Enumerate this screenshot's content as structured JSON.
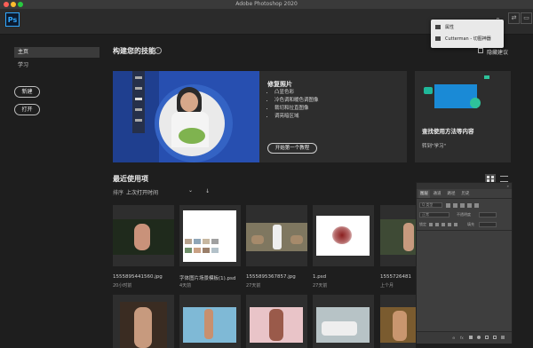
{
  "titlebar": {
    "title": "Adobe Photoshop 2020"
  },
  "app": {
    "logo": "Ps"
  },
  "icons": {
    "search": "⌕",
    "ps": "Ps"
  },
  "window_buttons": [
    "⇄",
    "▭"
  ],
  "sidebar": {
    "items": [
      {
        "label": "主页"
      },
      {
        "label": "学习"
      }
    ],
    "new_button": "新建",
    "open_button": "打开"
  },
  "skills": {
    "title": "构建您的技能",
    "hide_suggestions": "隐藏建议",
    "hero": {
      "heading": "修复照片",
      "bullets": [
        "凸显色彩",
        "冷色调和暖色调图像",
        "裁切和拉直图像",
        "调亮暗区域"
      ],
      "cta": "开始第一个教程"
    },
    "learn_card": {
      "heading": "查找使用方法等内容",
      "link": "转到\"学习\""
    }
  },
  "recent": {
    "title": "最近使用项",
    "sort_label": "排序",
    "sort_value": "上次打开时间",
    "sort_dir": "↓",
    "files": [
      {
        "name": "1555895441560.jpg",
        "meta": "20小时前"
      },
      {
        "name": "字体图片场景模板(1).psd",
        "meta": "4天前"
      },
      {
        "name": "1555895367857.jpg",
        "meta": "27天前"
      },
      {
        "name": "1.psd",
        "meta": "27天前"
      },
      {
        "name": "1555726481",
        "meta": "上个月"
      }
    ]
  },
  "popup": {
    "items": [
      {
        "label": "属性"
      },
      {
        "label": "Cutterman - 切图神器"
      }
    ]
  },
  "layers_panel": {
    "tabs": [
      "图层",
      "通道",
      "路径",
      "历史"
    ],
    "filter_placeholder": "Q 类型",
    "blend_mode": "正常",
    "opacity_label": "不透明度",
    "lock_label": "锁定",
    "fill_label": "填充"
  }
}
